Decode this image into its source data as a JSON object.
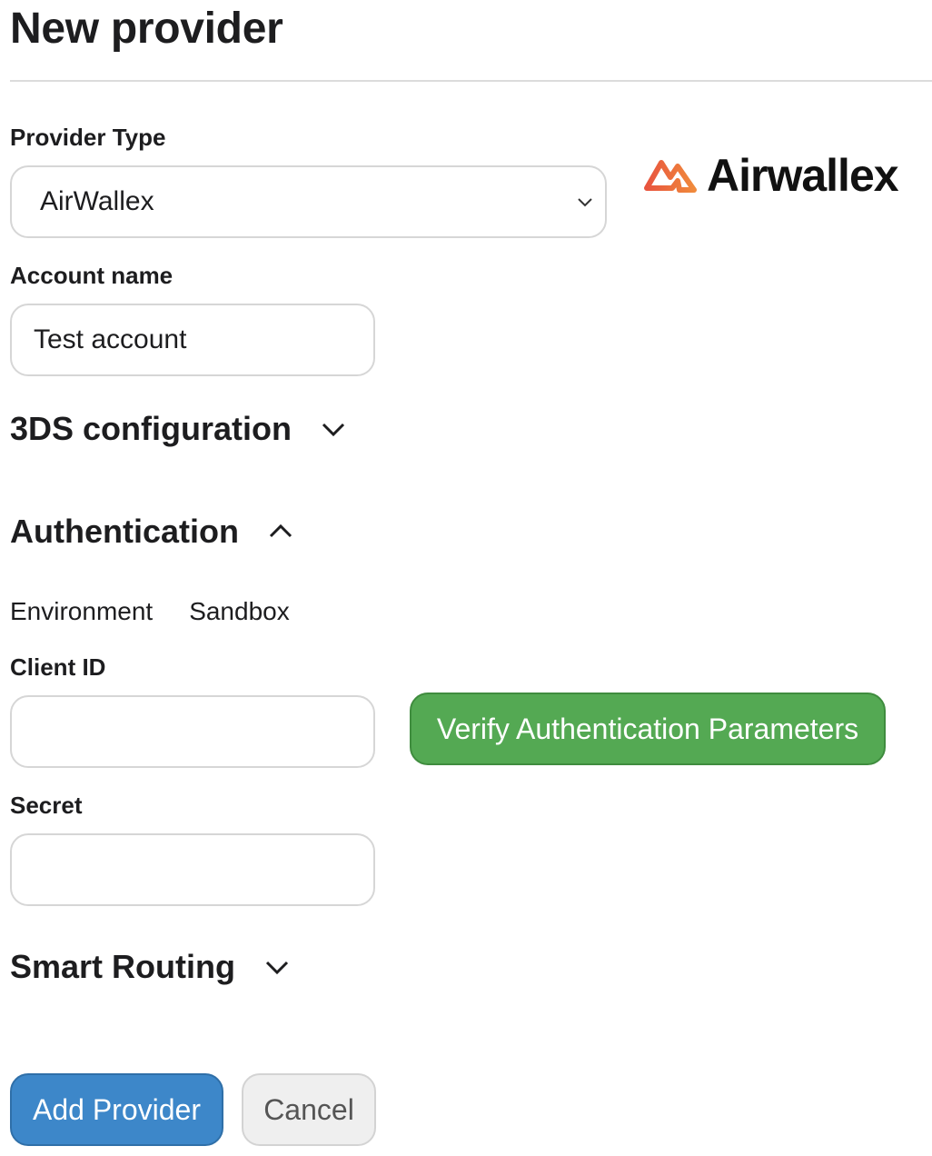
{
  "page": {
    "title": "New provider"
  },
  "provider_type": {
    "label": "Provider Type",
    "selected": "AirWallex",
    "logo_text": "Airwallex"
  },
  "account_name": {
    "label": "Account name",
    "value": "Test account"
  },
  "sections": {
    "threeds": {
      "title": "3DS configuration",
      "state": "collapsed"
    },
    "authentication": {
      "title": "Authentication",
      "state": "expanded"
    },
    "smart_routing": {
      "title": "Smart Routing",
      "state": "collapsed"
    }
  },
  "authentication": {
    "environment_label": "Environment",
    "environment_value": "Sandbox",
    "client_id_label": "Client ID",
    "client_id_value": "",
    "secret_label": "Secret",
    "secret_value": "",
    "verify_label": "Verify Authentication Parameters"
  },
  "actions": {
    "add_label": "Add Provider",
    "cancel_label": "Cancel"
  },
  "colors": {
    "verify": "#54a953",
    "primary": "#3d87c9",
    "logo_accent": "#e8543e"
  },
  "icons": [
    "chevron-down-icon",
    "chevron-up-icon",
    "airwallex-logo"
  ]
}
